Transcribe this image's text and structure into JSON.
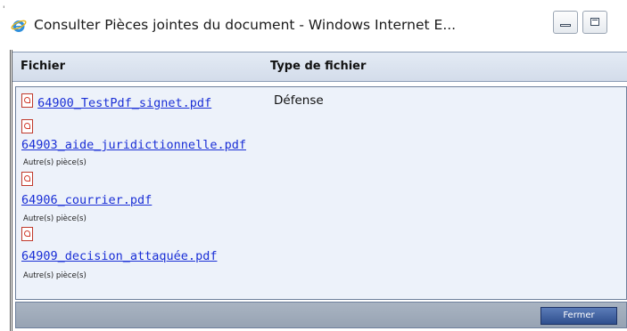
{
  "window": {
    "title": "Consulter Pièces jointes du document - Windows Internet E...",
    "minimize_icon": "minimize-icon",
    "maximize_icon": "maximize-icon"
  },
  "table": {
    "headers": {
      "file": "Fichier",
      "type": "Type de fichier"
    },
    "rows": [
      {
        "file": "64900_TestPdf_signet.pdf",
        "type": "Défense"
      },
      {
        "file": "64903_aide_juridictionnelle.pdf",
        "type": "Autre(s) pièce(s)"
      },
      {
        "file": "64906_courrier.pdf",
        "type": "Autre(s) pièce(s)"
      },
      {
        "file": "64909_decision_attaquée.pdf",
        "type": "Autre(s) pièce(s)"
      }
    ]
  },
  "footer": {
    "close_label": "Fermer"
  },
  "colors": {
    "link": "#1a2fd6",
    "header_bg": "#d3dcea",
    "button_bg": "#2f4f8e"
  }
}
